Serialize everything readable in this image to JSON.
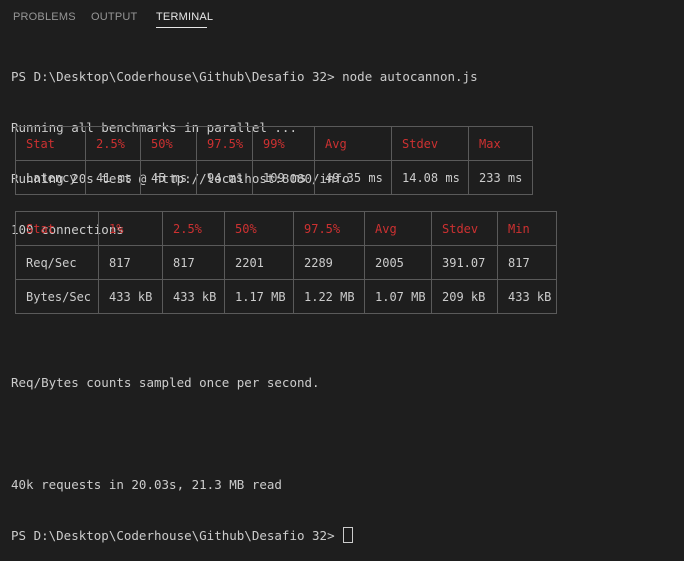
{
  "panel": {
    "tabs": [
      {
        "label": "PROBLEMS"
      },
      {
        "label": "OUTPUT"
      },
      {
        "label": "TERMINAL"
      }
    ]
  },
  "terminal": {
    "command_prompt": "PS D:\\Desktop\\Coderhouse\\Github\\Desafio 32> node autocannon.js",
    "line1": "Running all benchmarks in parallel ...",
    "line2": "Running 20s test @ http://localhost:8080/info",
    "line3": "100 connections",
    "sampled_note": "Req/Bytes counts sampled once per second.",
    "summary": "40k requests in 20.03s, 21.3 MB read",
    "prompt": "PS D:\\Desktop\\Coderhouse\\Github\\Desafio 32> "
  },
  "latency_table": {
    "headers": [
      "Stat",
      "2.5%",
      "50%",
      "97.5%",
      "99%",
      "Avg",
      "Stdev",
      "Max"
    ],
    "rows": [
      [
        "Latency",
        "41 ms",
        "45 ms",
        "94 ms",
        "109 ms",
        "49.35 ms",
        "14.08 ms",
        "233 ms"
      ]
    ]
  },
  "throughput_table": {
    "headers": [
      "Stat",
      "1%",
      "2.5%",
      "50%",
      "97.5%",
      "Avg",
      "Stdev",
      "Min"
    ],
    "rows": [
      [
        "Req/Sec",
        "817",
        "817",
        "2201",
        "2289",
        "2005",
        "391.07",
        "817"
      ],
      [
        "Bytes/Sec",
        "433 kB",
        "433 kB",
        "1.17 MB",
        "1.22 MB",
        "1.07 MB",
        "209 kB",
        "433 kB"
      ]
    ]
  },
  "colors": {
    "background": "#1e1e1e",
    "text": "#cccccc",
    "table_header": "#cd3131",
    "table_border": "#5a5a5a"
  }
}
